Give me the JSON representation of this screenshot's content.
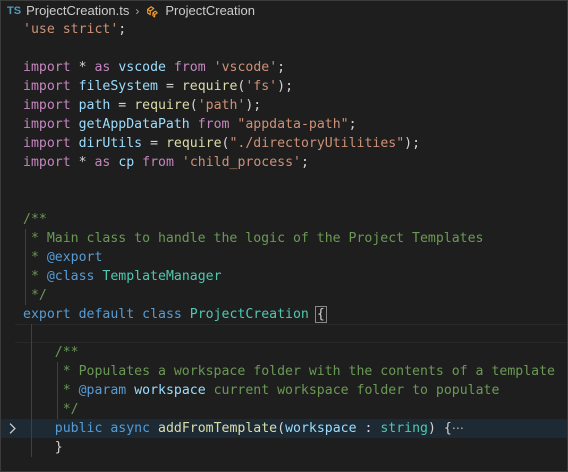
{
  "breadcrumb": {
    "file_badge": "TS",
    "file_name": "ProjectCreation.ts",
    "separator": "›",
    "symbol_name": "ProjectCreation",
    "symbol_icon": "class-icon"
  },
  "code": {
    "line1": {
      "t1": "'use strict'",
      "t2": ";"
    },
    "line3": {
      "t1": "import",
      "t2": " * ",
      "t3": "as",
      "t4": " ",
      "t5": "vscode",
      "t6": " ",
      "t7": "from",
      "t8": " ",
      "t9": "'vscode'",
      "t10": ";"
    },
    "line4": {
      "t1": "import",
      "t2": " ",
      "t3": "fileSystem",
      "t4": " = ",
      "t5": "require",
      "t6": "(",
      "t7": "'fs'",
      "t8": ");"
    },
    "line5": {
      "t1": "import",
      "t2": " ",
      "t3": "path",
      "t4": " = ",
      "t5": "require",
      "t6": "(",
      "t7": "'path'",
      "t8": ");"
    },
    "line6": {
      "t1": "import",
      "t2": " ",
      "t3": "getAppDataPath",
      "t4": " ",
      "t5": "from",
      "t6": " ",
      "t7": "\"appdata-path\"",
      "t8": ";"
    },
    "line7": {
      "t1": "import",
      "t2": " ",
      "t3": "dirUtils",
      "t4": " = ",
      "t5": "require",
      "t6": "(",
      "t7": "\"./directoryUtilities\"",
      "t8": ");"
    },
    "line8": {
      "t1": "import",
      "t2": " * ",
      "t3": "as",
      "t4": " ",
      "t5": "cp",
      "t6": " ",
      "t7": "from",
      "t8": " ",
      "t9": "'child_process'",
      "t10": ";"
    },
    "line11": {
      "t1": "/**"
    },
    "line12": {
      "t1": " * Main class to handle the logic of the Project Templates"
    },
    "line13": {
      "t1": " * ",
      "t2": "@export"
    },
    "line14": {
      "t1": " * ",
      "t2": "@class",
      "t3": " ",
      "t4": "TemplateManager"
    },
    "line15": {
      "t1": " */"
    },
    "line16": {
      "t1": "export",
      "t2": " ",
      "t3": "default",
      "t4": " ",
      "t5": "class",
      "t6": " ",
      "t7": "ProjectCreation",
      "t8": " ",
      "t9": "{"
    },
    "line18": {
      "t1": "/**"
    },
    "line19": {
      "t1": " * Populates a workspace folder with the contents of a template"
    },
    "line20": {
      "t1": " * ",
      "t2": "@param",
      "t3": " ",
      "t4": "workspace",
      "t5": " current workspace folder to populate"
    },
    "line21": {
      "t1": " */"
    },
    "line22": {
      "t1": "public",
      "t2": " ",
      "t3": "async",
      "t4": " ",
      "t5": "addFromTemplate",
      "t6": "(",
      "t7": "workspace",
      "t8": " : ",
      "t9": "string",
      "t10": ") {",
      "t11": "⋯"
    },
    "line23": {
      "t1": "}"
    }
  },
  "colors": {
    "background": "#1e1e1e",
    "keyword": "#569cd6",
    "control_keyword": "#c586c0",
    "string": "#ce9178",
    "variable": "#9cdcfe",
    "function": "#dcdcaa",
    "type": "#4ec9b0",
    "comment": "#6a9955",
    "ts_badge": "#519aba"
  },
  "icons": {
    "breadcrumb_class": "class-icon",
    "fold_marker": "chevron-right-icon"
  }
}
